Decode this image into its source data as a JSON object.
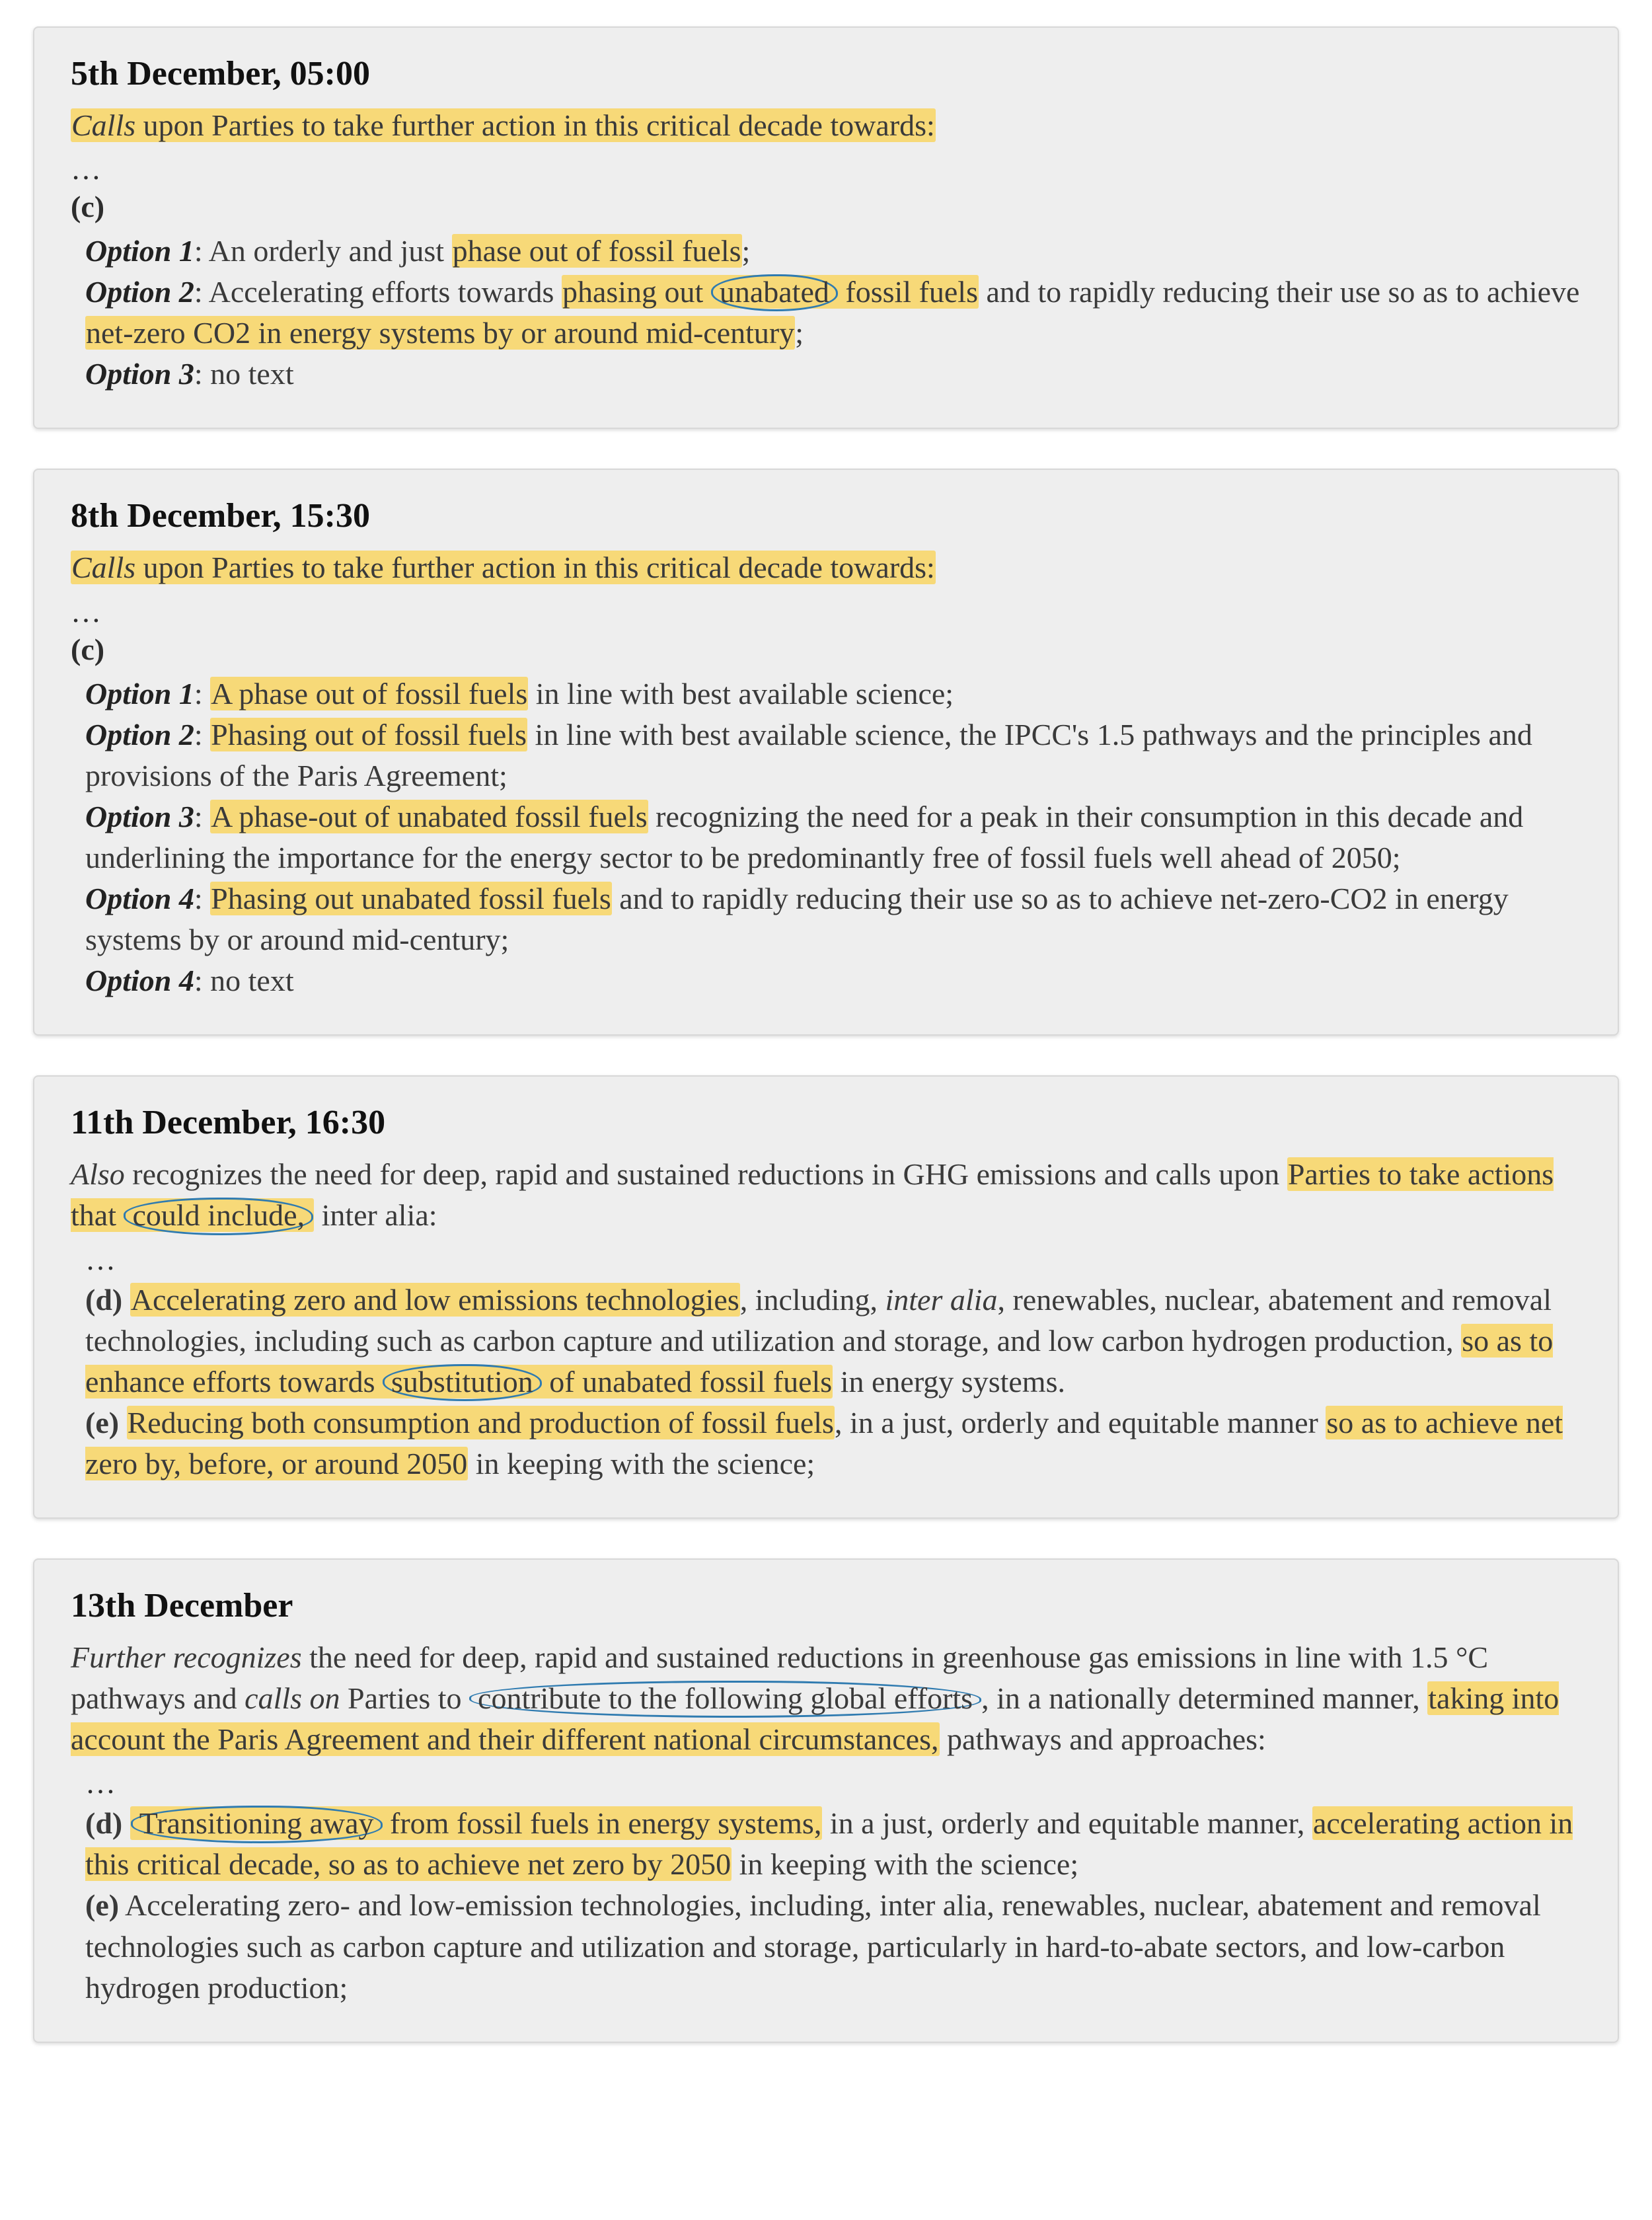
{
  "cards": [
    {
      "heading": "5th December, 05:00",
      "intro_ital": "Calls",
      "intro_plain": " upon Parties to take further action in this critical decade towards:",
      "ellipsis": "…",
      "clause": "(c)",
      "options": [
        {
          "label": "Option 1",
          "pre": ": An orderly and just ",
          "hl": "phase out of fossil fuels",
          "post": ";"
        },
        {
          "label": "Option 2",
          "pre": ": Accelerating efforts towards ",
          "hl_a": "phasing out ",
          "circle": "unabated",
          "hl_b": " fossil fuels",
          "mid": " and to rapidly reducing their use so as to achieve ",
          "hl_c": "net-zero CO2 in energy systems by or around mid-century",
          "post": ";"
        },
        {
          "label": "Option 3",
          "plain": ": no text"
        }
      ]
    },
    {
      "heading": "8th December, 15:30",
      "intro_ital": "Calls",
      "intro_plain": " upon Parties to take further action in this critical decade towards:",
      "ellipsis": "…",
      "clause": "(c)",
      "options": [
        {
          "label": "Option 1",
          "pre": ": ",
          "hl": "A phase out of fossil fuels",
          "post": " in line with best available science;"
        },
        {
          "label": "Option 2",
          "pre": ": ",
          "hl": "Phasing out of fossil fuels",
          "post": " in line with best available science, the IPCC's 1.5 pathways and the principles and provisions of the Paris Agreement;"
        },
        {
          "label": "Option 3",
          "pre": ": ",
          "hl": "A phase-out of unabated fossil fuels",
          "post": " recognizing the need for a peak in their consumption in this decade and underlining the importance for the energy sector to be predominantly free of fossil fuels well ahead of 2050;"
        },
        {
          "label": "Option 4",
          "pre": ": ",
          "hl": "Phasing out unabated fossil fuels",
          "post": " and to rapidly reducing their use so as to achieve net-zero-CO2 in energy systems by or around mid-century;"
        },
        {
          "label": "Option 4",
          "plain": ": no text"
        }
      ]
    },
    {
      "heading": "11th December, 16:30",
      "intro_ital": "Also",
      "intro_plain_a": " recognizes the need for deep, rapid and sustained reductions in GHG emissions and calls upon ",
      "intro_hl_a": "Parties to take actions that ",
      "intro_circle": "could include,",
      "intro_plain_b": " inter alia:",
      "ellipsis": "…",
      "items": [
        {
          "letter": "(d)",
          "hl1": "Accelerating zero and low emissions technologies",
          "plain1": ", including, ",
          "ital1": "inter alia",
          "plain2": ", renewables, nuclear, abatement and removal technologies, including such as carbon capture and utilization and storage, and low carbon hydrogen production, ",
          "hl2a": "so as to enhance efforts towards ",
          "circle2": "substitution",
          "hl2b": " of unabated fossil fuels",
          "plain3": " in energy systems."
        },
        {
          "letter": "(e)",
          "hl1": "Reducing both consumption and production of fossil fuels",
          "plain1": ", in a just, orderly and equitable manner ",
          "hl2": "so as to achieve net zero by, before, or around 2050",
          "plain2": " in keeping with the science;"
        }
      ]
    },
    {
      "heading": "13th December",
      "intro_ital1": "Further recognizes",
      "plain1": " the need for deep, rapid and sustained reductions in greenhouse gas emissions in line with 1.5 °C pathways and ",
      "ital2": "calls on",
      "plain2": " Parties to ",
      "circle1": "contribute to the following global efforts",
      "plain3": ", in a nationally determined manner, ",
      "hl1": "taking into account the Paris Agreement and their different national circumstances,",
      "plain4": " pathways and approaches:",
      "ellipsis": "…",
      "items": [
        {
          "letter": "(d)",
          "circle": "Transitioning away",
          "hl_a": " from fossil fuels in energy systems,",
          "plain_a": " in a just, orderly and equitable manner, ",
          "hl_b": "accelerating action in this critical decade, so as to achieve net zero by 2050",
          "plain_b": " in keeping with the science;"
        },
        {
          "letter": "(e)",
          "plain": " Accelerating zero- and low-emission technologies, including, inter alia, renewables, nuclear, abatement and removal technologies such as carbon capture and utilization and storage, particularly in hard-to-abate sectors, and low-carbon hydrogen production;"
        }
      ]
    }
  ]
}
